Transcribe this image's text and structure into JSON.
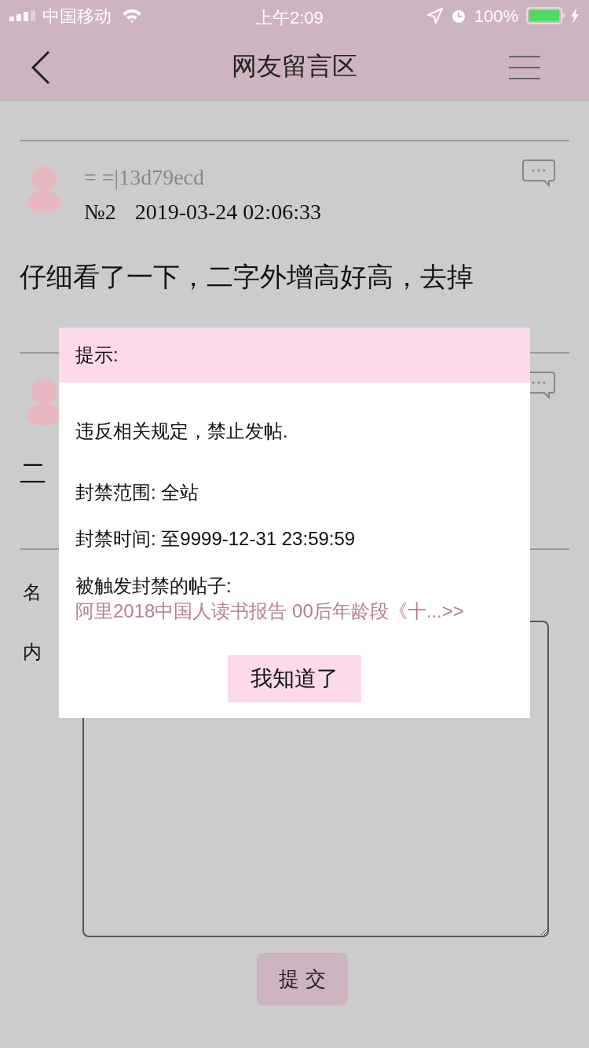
{
  "status_bar": {
    "carrier": "中国移动",
    "time": "上午2:09",
    "battery": "100%"
  },
  "nav": {
    "title": "网友留言区"
  },
  "posts": [
    {
      "kind": "post",
      "author": "= =|13d79ecd",
      "number": "№2",
      "time": "2019-03-24 02:06:33",
      "body": "仔细看了一下，二字外增高好高，去掉"
    },
    {
      "kind": "post",
      "body": "二"
    }
  ],
  "form": {
    "name_label": "名",
    "content_label": "内",
    "submit": "提 交"
  },
  "dialog": {
    "title": "提示:",
    "message": "违反相关规定，禁止发帖.",
    "scope": "封禁范围: 全站",
    "time": "封禁时间: 至9999-12-31 23:59:59",
    "post_label": "被触发封禁的帖子: ",
    "post_link": "阿里2018中国人读书报告 00后年龄段《十...>>",
    "button": "我知道了"
  }
}
